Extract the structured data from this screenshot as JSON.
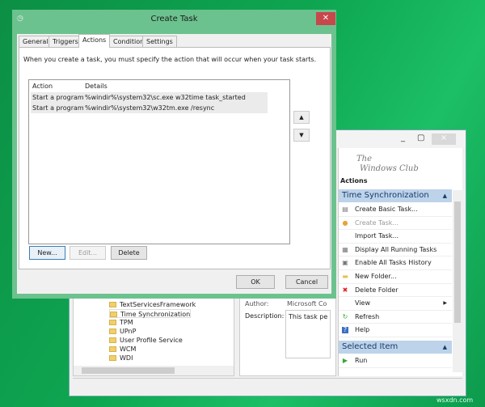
{
  "background_window": {
    "logo": {
      "line1": "The",
      "line2": "Windows Club"
    },
    "tree_items": [
      "TextServicesFramework",
      "Time Synchronization",
      "TPM",
      "UPnP",
      "User Profile Service",
      "WCM",
      "WDI"
    ],
    "details": {
      "author_label": "Author:",
      "author_value": "Microsoft Co",
      "description_label": "Description:",
      "description_value": "This task pe"
    },
    "actions_title": "Actions",
    "section1": "Time Synchronization",
    "section1_items": [
      {
        "label": "Create Basic Task...",
        "icon": "wizard-icon"
      },
      {
        "label": "Create Task...",
        "icon": "task-icon"
      },
      {
        "label": "Import Task...",
        "icon": ""
      },
      {
        "label": "Display All Running Tasks",
        "icon": "list-icon"
      },
      {
        "label": "Enable All Tasks History",
        "icon": "history-icon"
      },
      {
        "label": "New Folder...",
        "icon": "folder-icon"
      },
      {
        "label": "Delete Folder",
        "icon": "delete-icon"
      },
      {
        "label": "View",
        "icon": ""
      },
      {
        "label": "Refresh",
        "icon": "refresh-icon"
      },
      {
        "label": "Help",
        "icon": "help-icon"
      }
    ],
    "section2": "Selected Item",
    "section2_items": [
      {
        "label": "Run",
        "icon": "run-icon"
      }
    ]
  },
  "dialog": {
    "title": "Create Task",
    "tabs": [
      "General",
      "Triggers",
      "Actions",
      "Conditions",
      "Settings"
    ],
    "active_tab": "Actions",
    "instruction": "When you create a task, you must specify the action that will occur when your task starts.",
    "columns": [
      "Action",
      "Details"
    ],
    "rows": [
      {
        "action": "Start a program",
        "details": "%windir%\\system32\\sc.exe w32time task_started"
      },
      {
        "action": "Start a program",
        "details": "%windir%\\system32\\w32tm.exe /resync"
      }
    ],
    "buttons": {
      "new": "New...",
      "edit": "Edit...",
      "delete": "Delete",
      "ok": "OK",
      "cancel": "Cancel"
    }
  },
  "watermark": "wsxdn.com",
  "colors": {
    "dialog_frame": "#6cc28e",
    "close": "#c7474a",
    "section_header": "#bcd3ea"
  }
}
